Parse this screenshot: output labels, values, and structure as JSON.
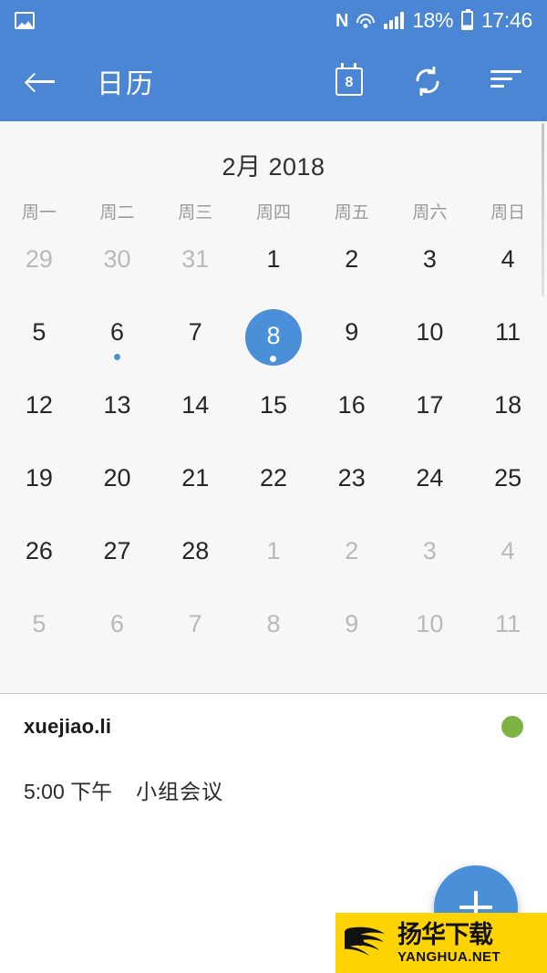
{
  "status_bar": {
    "left_icon": "image-notification-icon",
    "nfc_label": "N",
    "battery_percent": "18%",
    "clock": "17:46"
  },
  "app_bar": {
    "back_label": "←",
    "title": "日历",
    "today_badge": "8",
    "icons": [
      "calendar-today-icon",
      "sync-icon",
      "agenda-sort-icon"
    ]
  },
  "calendar": {
    "month_title": "2月 2018",
    "weekdays": [
      "周一",
      "周二",
      "周三",
      "周四",
      "周五",
      "周六",
      "周日"
    ],
    "selected_day": 8,
    "accent_color": "#4a90d9",
    "weeks": [
      [
        {
          "d": "29",
          "other": true
        },
        {
          "d": "30",
          "other": true
        },
        {
          "d": "31",
          "other": true
        },
        {
          "d": "1",
          "other": false
        },
        {
          "d": "2",
          "other": false
        },
        {
          "d": "3",
          "other": false
        },
        {
          "d": "4",
          "other": false
        }
      ],
      [
        {
          "d": "5",
          "other": false
        },
        {
          "d": "6",
          "other": false,
          "dot": true
        },
        {
          "d": "7",
          "other": false
        },
        {
          "d": "8",
          "other": false,
          "dot": true,
          "selected": true
        },
        {
          "d": "9",
          "other": false
        },
        {
          "d": "10",
          "other": false
        },
        {
          "d": "11",
          "other": false
        }
      ],
      [
        {
          "d": "12",
          "other": false
        },
        {
          "d": "13",
          "other": false
        },
        {
          "d": "14",
          "other": false
        },
        {
          "d": "15",
          "other": false
        },
        {
          "d": "16",
          "other": false
        },
        {
          "d": "17",
          "other": false
        },
        {
          "d": "18",
          "other": false
        }
      ],
      [
        {
          "d": "19",
          "other": false
        },
        {
          "d": "20",
          "other": false
        },
        {
          "d": "21",
          "other": false
        },
        {
          "d": "22",
          "other": false
        },
        {
          "d": "23",
          "other": false
        },
        {
          "d": "24",
          "other": false
        },
        {
          "d": "25",
          "other": false
        }
      ],
      [
        {
          "d": "26",
          "other": false
        },
        {
          "d": "27",
          "other": false
        },
        {
          "d": "28",
          "other": false
        },
        {
          "d": "1",
          "other": true
        },
        {
          "d": "2",
          "other": true
        },
        {
          "d": "3",
          "other": true
        },
        {
          "d": "4",
          "other": true
        }
      ],
      [
        {
          "d": "5",
          "other": true
        },
        {
          "d": "6",
          "other": true
        },
        {
          "d": "7",
          "other": true
        },
        {
          "d": "8",
          "other": true
        },
        {
          "d": "9",
          "other": true
        },
        {
          "d": "10",
          "other": true
        },
        {
          "d": "11",
          "other": true
        }
      ]
    ]
  },
  "agenda": {
    "account_name": "xuejiao.li",
    "account_color": "#7cb342",
    "events": [
      {
        "time": "5:00 下午",
        "title": "小组会议"
      }
    ]
  },
  "fab": {
    "label": "+",
    "color": "#4a90d9"
  },
  "watermark": {
    "cn": "扬华下载",
    "en": "YANGHUA.NET",
    "bg": "#FFD400"
  }
}
